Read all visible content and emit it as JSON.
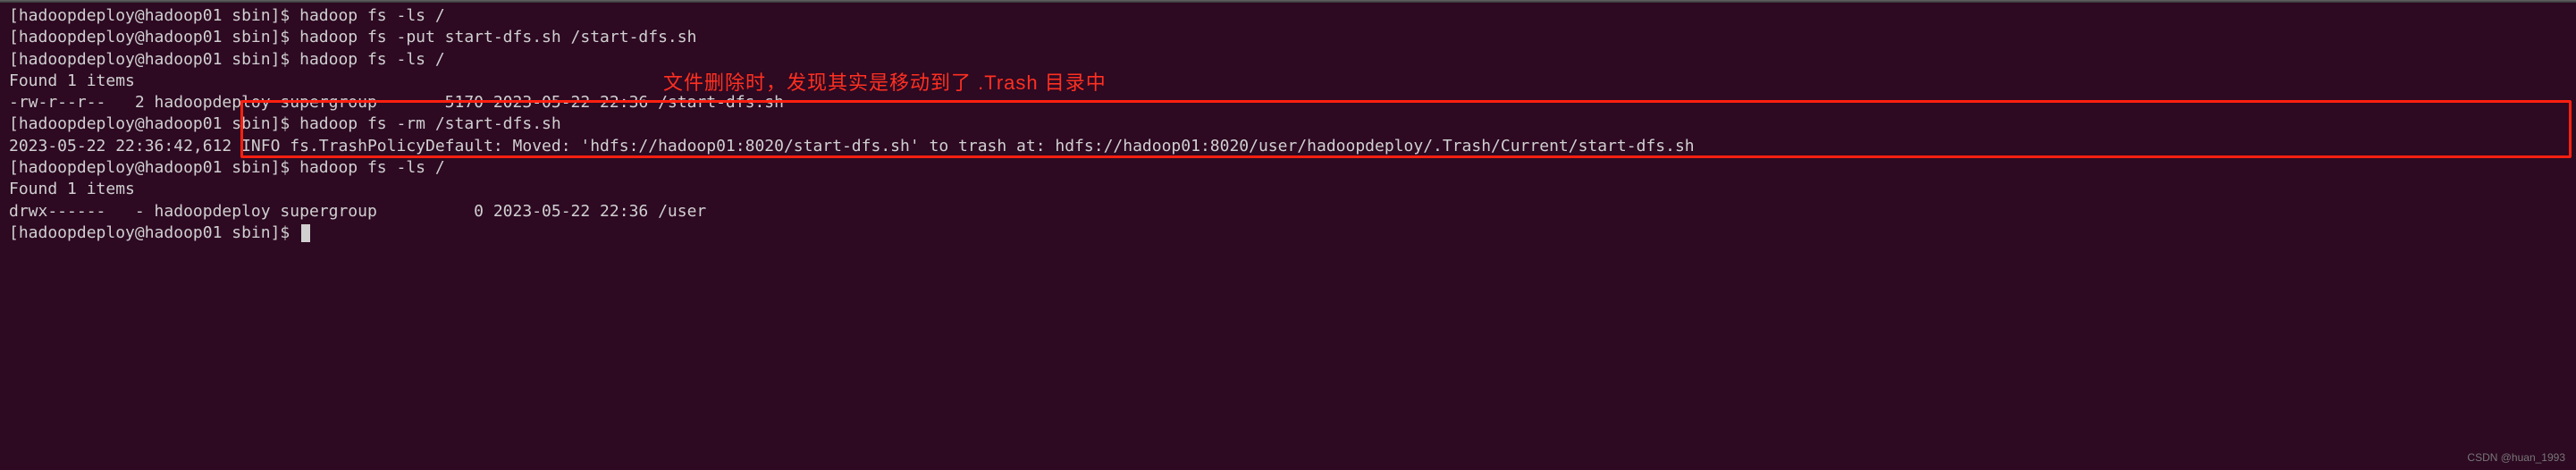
{
  "prompt": "[hadoopdeploy@hadoop01 sbin]$ ",
  "lines": {
    "l0": "hadoop fs -ls /",
    "l1": "hadoop fs -put start-dfs.sh /start-dfs.sh",
    "l2": "hadoop fs -ls /",
    "l3": "Found 1 items",
    "l4": "-rw-r--r--   2 hadoopdeploy supergroup       5170 2023-05-22 22:36 /start-dfs.sh",
    "l5": "hadoop fs -rm /start-dfs.sh",
    "l6": "2023-05-22 22:36:42,612 INFO fs.TrashPolicyDefault: Moved: 'hdfs://hadoop01:8020/start-dfs.sh' to trash at: hdfs://hadoop01:8020/user/hadoopdeploy/.Trash/Current/start-dfs.sh",
    "l7": "hadoop fs -ls /",
    "l8": "Found 1 items",
    "l9": "drwx------   - hadoopdeploy supergroup          0 2023-05-22 22:36 /user",
    "l10": ""
  },
  "annotation_text": "文件删除时，发现其实是移动到了 .Trash 目录中",
  "watermark": "CSDN @huan_1993"
}
